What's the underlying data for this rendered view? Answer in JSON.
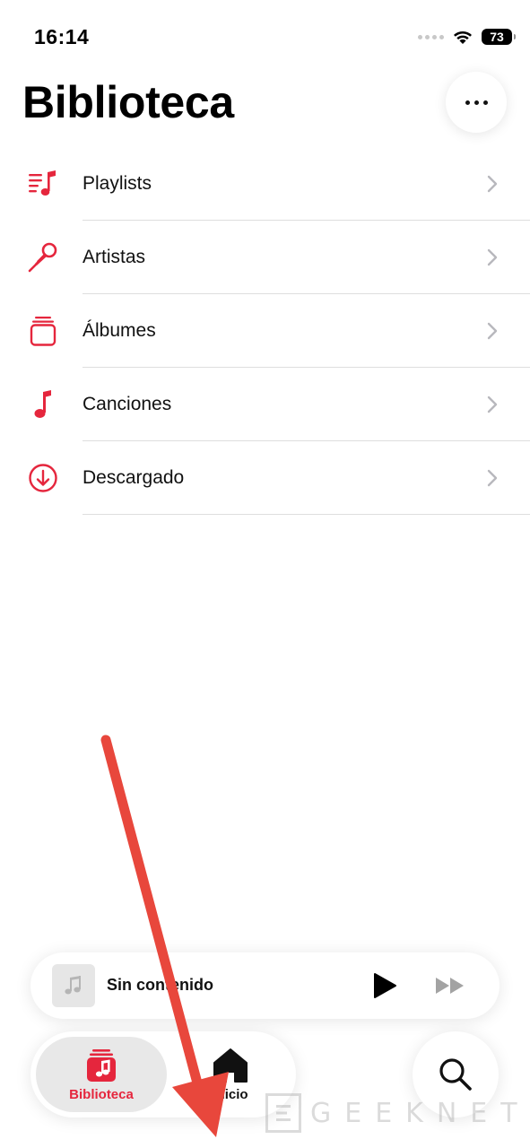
{
  "status_bar": {
    "time": "16:14",
    "battery": "73"
  },
  "header": {
    "title": "Biblioteca"
  },
  "library": {
    "items": [
      {
        "label": "Playlists",
        "icon": "playlist-icon"
      },
      {
        "label": "Artistas",
        "icon": "microphone-icon"
      },
      {
        "label": "Álbumes",
        "icon": "album-stack-icon"
      },
      {
        "label": "Canciones",
        "icon": "music-note-icon"
      },
      {
        "label": "Descargado",
        "icon": "download-circle-icon"
      }
    ]
  },
  "mini_player": {
    "title": "Sin contenido"
  },
  "tab_bar": {
    "library_label": "Biblioteca",
    "home_label": "Inicio"
  },
  "watermark": {
    "text": "GEEKNETIC"
  },
  "colors": {
    "accent": "#e5263d",
    "annotation_arrow": "#e8473c"
  }
}
